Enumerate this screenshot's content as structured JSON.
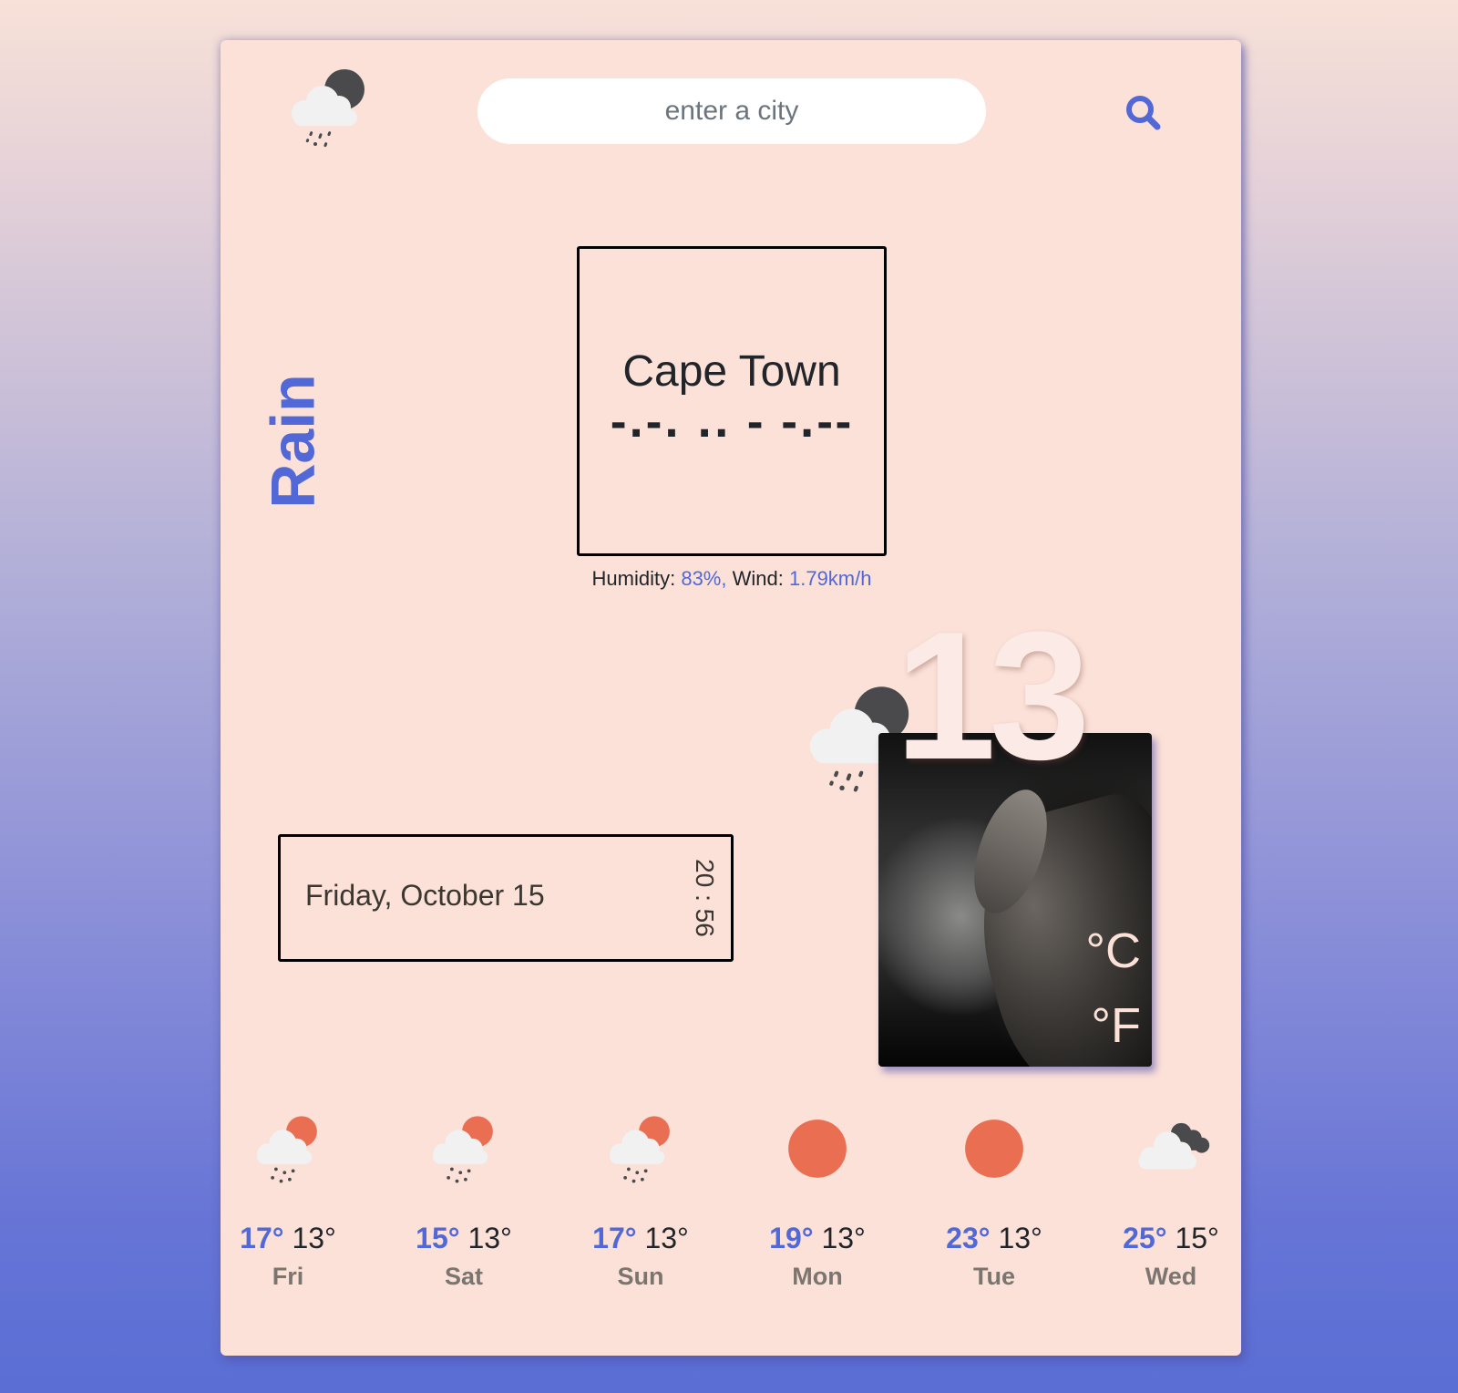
{
  "header": {
    "icon": "rain-night-icon",
    "search": {
      "placeholder": "enter a city",
      "value": ""
    },
    "search_button_icon": "search-icon"
  },
  "current": {
    "condition": "Rain",
    "city": "Cape Town",
    "city_morse": "-.-. .. - -.--",
    "humidity_label": "Humidity:",
    "humidity_value": "83%,",
    "wind_label": "Wind:",
    "wind_value": "1.79km/h",
    "date": "Friday, October 15",
    "time": "20 : 56",
    "icon": "rain-night-icon",
    "temperature": "13",
    "unit_celsius": "°C",
    "unit_fahrenheit": "°F",
    "photo": "roaring-lion-photo"
  },
  "forecast": [
    {
      "day": "Fri",
      "max": "17°",
      "min": "13°",
      "icon": "rain-sun-icon"
    },
    {
      "day": "Sat",
      "max": "15°",
      "min": "13°",
      "icon": "rain-sun-icon"
    },
    {
      "day": "Sun",
      "max": "17°",
      "min": "13°",
      "icon": "rain-sun-icon"
    },
    {
      "day": "Mon",
      "max": "19°",
      "min": "13°",
      "icon": "sun-icon"
    },
    {
      "day": "Tue",
      "max": "23°",
      "min": "13°",
      "icon": "sun-icon"
    },
    {
      "day": "Wed",
      "max": "25°",
      "min": "15°",
      "icon": "cloudy-icon"
    }
  ],
  "colors": {
    "accent": "#5268d6",
    "card_bg": "#fbe1d8",
    "sun": "#ea6e52",
    "moon": "#4a4a4c",
    "cloud": "#f1f1f1"
  }
}
